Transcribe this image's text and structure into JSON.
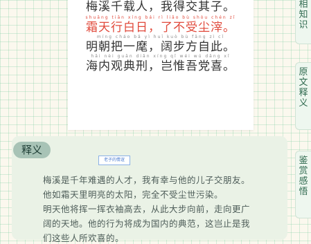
{
  "poem": {
    "lines": [
      {
        "pinyin": "",
        "text": "梅溪千载人，我得交其子。",
        "highlight": false
      },
      {
        "pinyin": "shuāng tiān xíng bái rì   liǎo bù shòu chén zǐ",
        "text": "霜天行白日，了不受尘滓。",
        "highlight": true
      },
      {
        "pinyin": "míng cháo bǎ yì huī   kuò bù fāng zì cǐ",
        "text": "明朝把一麾，阔步方自此。",
        "highlight": false
      },
      {
        "pinyin": "hǎi nèi guān diǎn xíng   qǐ wéi wú dǎng xǐ",
        "text": "海内观典刑，岂惟吾党喜。",
        "highlight": false
      }
    ]
  },
  "tabs": [
    {
      "label": "相知识",
      "chars": [
        "相",
        "知",
        "识"
      ]
    },
    {
      "label": "原文释义",
      "chars": [
        "原",
        "文",
        "释",
        "义"
      ]
    },
    {
      "label": "鉴赏感悟",
      "chars": [
        "鉴",
        "赏",
        "感",
        "悟"
      ]
    }
  ],
  "explanation": {
    "title": "释义",
    "stamp": "老子的情谊",
    "lines": [
      "梅溪是千年难遇的人才，我有幸与他的儿子交朋友。",
      "他如霜天里明亮的太阳，完全不受尘世污染。",
      "明天他将挥一挥衣袖高去，从此大步向前，走向更广",
      "阔的天地。他的行为将成为国内的典范，这岂止是我",
      "们这些人所欢喜的。"
    ]
  }
}
